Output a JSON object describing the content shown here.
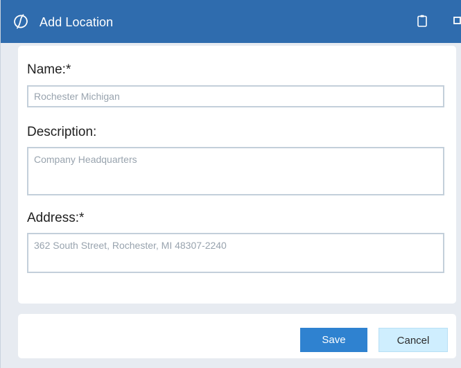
{
  "window": {
    "title": "Add Location",
    "icons": {
      "logo": "app-logo-icon",
      "clipboard": "clipboard-icon",
      "maximize": "maximize-icon"
    },
    "colors": {
      "titlebar": "#2f6cae",
      "background": "#e7ebf1",
      "save_button": "#2f82d0",
      "cancel_button": "#cfeefe"
    }
  },
  "form": {
    "name": {
      "label": "Name:*",
      "value": "Rochester Michigan"
    },
    "description": {
      "label": "Description:",
      "value": "Company Headquarters"
    },
    "address": {
      "label": "Address:*",
      "value": "362 South Street, Rochester, MI 48307-2240"
    }
  },
  "actions": {
    "save_label": "Save",
    "cancel_label": "Cancel"
  }
}
